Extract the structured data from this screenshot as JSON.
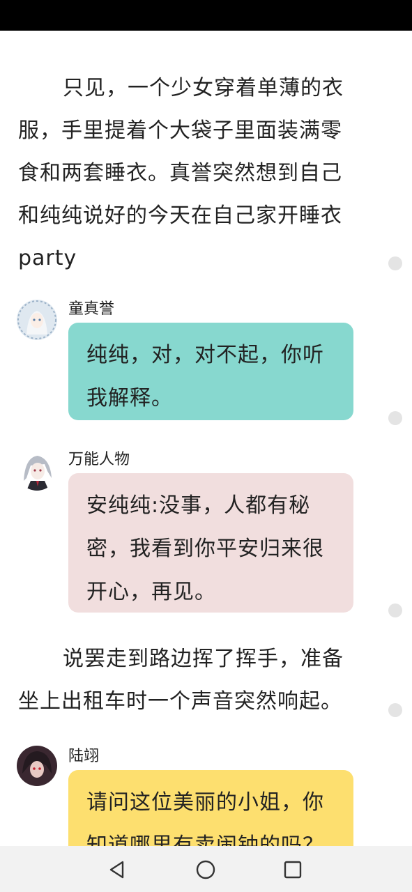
{
  "story": {
    "narration_1": "只见，一个少女穿着单薄的衣服，手里提着个大袋子里面装满零食和两套睡衣。真誉突然想到自己和纯纯说好的今天在自己家开睡衣party",
    "narration_2": "说罢走到路边挥了挥手，准备坐上出租车时一个声音突然响起。"
  },
  "messages": [
    {
      "speaker": "童真誉",
      "text": "纯纯，对，对不起，你听我解释。",
      "bubble_color": "#87d8cf"
    },
    {
      "speaker": "万能人物",
      "text": "安纯纯:没事，人都有秘密，我看到你平安归来很开心，再见。",
      "bubble_color": "#f1dede"
    },
    {
      "speaker": "陆翊",
      "text": "请问这位美丽的小姐，你知道哪里有卖闹钟的吗？",
      "bubble_color": "#fddf6f"
    }
  ],
  "nav": {
    "back": "back-icon",
    "home": "home-icon",
    "recents": "recents-icon"
  }
}
